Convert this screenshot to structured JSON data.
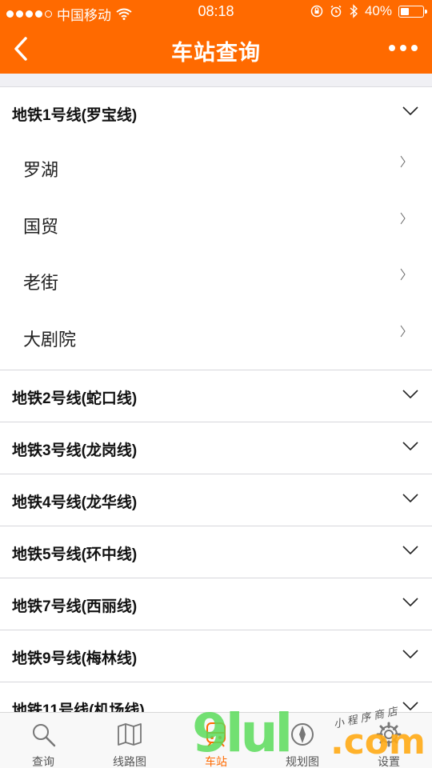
{
  "status_bar": {
    "carrier": "中国移动",
    "time": "08:18",
    "battery": "40%",
    "battery_level": 0.4
  },
  "nav": {
    "title": "车站查询",
    "back_icon": "chevron-left-icon",
    "more_icon": "more-dots-icon"
  },
  "colors": {
    "accent": "#ff6a00",
    "tab_active": "#ff6a00",
    "divider": "#d6d6da"
  },
  "lines": [
    {
      "name": "地铁1号线(罗宝线)",
      "expanded": true,
      "stations": [
        "罗湖",
        "国贸",
        "老街",
        "大剧院"
      ]
    },
    {
      "name": "地铁2号线(蛇口线)",
      "expanded": false
    },
    {
      "name": "地铁3号线(龙岗线)",
      "expanded": false
    },
    {
      "name": "地铁4号线(龙华线)",
      "expanded": false
    },
    {
      "name": "地铁5号线(环中线)",
      "expanded": false
    },
    {
      "name": "地铁7号线(西丽线)",
      "expanded": false
    },
    {
      "name": "地铁9号线(梅林线)",
      "expanded": false
    },
    {
      "name": "地铁11号线(机场线)",
      "expanded": false
    }
  ],
  "tabbar": {
    "items": [
      {
        "label": "查询",
        "icon": "search-icon",
        "active": false
      },
      {
        "label": "线路图",
        "icon": "map-icon",
        "active": false
      },
      {
        "label": "车站",
        "icon": "train-icon",
        "active": true
      },
      {
        "label": "规划图",
        "icon": "compass-icon",
        "active": false
      },
      {
        "label": "设置",
        "icon": "gear-icon",
        "active": false
      }
    ]
  },
  "watermark": {
    "main": "9lul",
    "domain": ".com",
    "caption": "小程序商店"
  }
}
